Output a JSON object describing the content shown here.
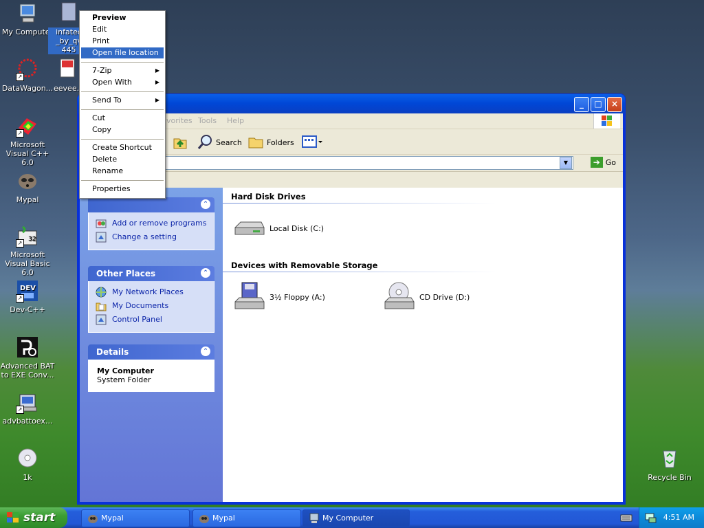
{
  "desktop": {
    "icons": [
      {
        "label": "My Computer"
      },
      {
        "label": "infatec\n_by_qv\n445",
        "selected": true
      },
      {
        "label": "DataWagon..."
      },
      {
        "label": "eevee..."
      },
      {
        "label": "Microsoft Visual C++ 6.0"
      },
      {
        "label": "Mypal"
      },
      {
        "label": "Microsoft Visual Basic 6.0"
      },
      {
        "label": "Dev-C++"
      },
      {
        "label": "Advanced BAT to EXE Conv..."
      },
      {
        "label": "advbattoex..."
      },
      {
        "label": "1k"
      },
      {
        "label": "Recycle Bin"
      }
    ]
  },
  "context_menu": {
    "items": [
      {
        "label": "Preview",
        "bold": true
      },
      {
        "label": "Edit"
      },
      {
        "label": "Print"
      },
      {
        "label": "Open file location",
        "highlighted": true
      },
      {
        "label": "7-Zip",
        "submenu": true
      },
      {
        "label": "Open With",
        "submenu": true
      },
      {
        "label": "Send To",
        "submenu": true
      },
      {
        "label": "Cut"
      },
      {
        "label": "Copy"
      },
      {
        "label": "Create Shortcut"
      },
      {
        "label": "Delete"
      },
      {
        "label": "Rename"
      },
      {
        "label": "Properties"
      }
    ]
  },
  "window": {
    "menu": {
      "favorites_partial": "vorites",
      "tools": "Tools",
      "help": "Help"
    },
    "toolbar": {
      "search": "Search",
      "folders": "Folders"
    },
    "address": {
      "value_partial": "er",
      "go": "Go"
    },
    "tasks": {
      "system_tasks": [
        "Add or remove programs",
        "Change a setting"
      ],
      "other_places": {
        "title": "Other Places",
        "items": [
          "My Network Places",
          "My Documents",
          "Control Panel"
        ]
      },
      "details": {
        "title": "Details",
        "name": "My Computer",
        "type": "System Folder"
      }
    },
    "groups": {
      "hard_disks": {
        "title": "Hard Disk Drives",
        "drives": [
          "Local Disk (C:)"
        ]
      },
      "removable": {
        "title": "Devices with Removable Storage",
        "drives": [
          "3½ Floppy (A:)",
          "CD Drive (D:)"
        ]
      }
    }
  },
  "taskbar": {
    "start": "start",
    "buttons": [
      {
        "label": "Mypal"
      },
      {
        "label": "Mypal"
      },
      {
        "label": "My Computer",
        "active": true
      }
    ],
    "clock": "4:51 AM"
  }
}
